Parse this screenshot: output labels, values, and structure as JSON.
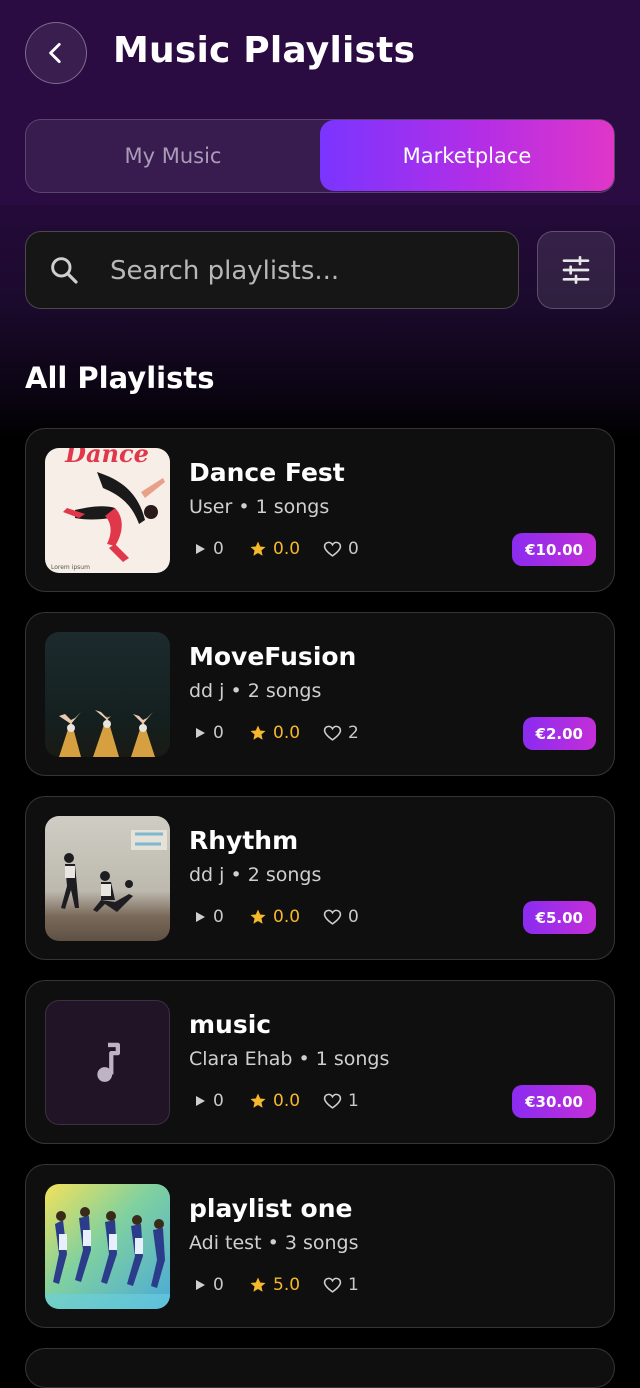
{
  "header": {
    "title": "Music Playlists"
  },
  "tabs": [
    {
      "label": "My Music",
      "active": false
    },
    {
      "label": "Marketplace",
      "active": true
    }
  ],
  "search": {
    "placeholder": "Search playlists..."
  },
  "section": {
    "title": "All Playlists"
  },
  "playlists": [
    {
      "title": "Dance Fest",
      "subtitle": "User • 1 songs",
      "plays": "0",
      "rating": "0.0",
      "likes": "0",
      "price": "€10.00",
      "cover": "dance-fest-art",
      "cover_caption": "Dance",
      "cover_footer": "Lorem ipsum"
    },
    {
      "title": "MoveFusion",
      "subtitle": "dd j • 2 songs",
      "plays": "0",
      "rating": "0.0",
      "likes": "2",
      "price": "€2.00",
      "cover": "dancers-photo"
    },
    {
      "title": "Rhythm",
      "subtitle": "dd j • 2 songs",
      "plays": "0",
      "rating": "0.0",
      "likes": "0",
      "price": "€5.00",
      "cover": "studio-dance-photo"
    },
    {
      "title": "music",
      "subtitle": "Clara Ehab • 1 songs",
      "plays": "0",
      "rating": "0.0",
      "likes": "1",
      "price": "€30.00",
      "cover": "music-note-icon"
    },
    {
      "title": "playlist one",
      "subtitle": "Adi test • 3 songs",
      "plays": "0",
      "rating": "5.0",
      "likes": "1",
      "price": "",
      "cover": "neon-dancers-art"
    }
  ],
  "colors": {
    "accent_start": "#7a35ff",
    "accent_end": "#e036c8",
    "rating": "#f5b82a",
    "background": "#000000"
  }
}
